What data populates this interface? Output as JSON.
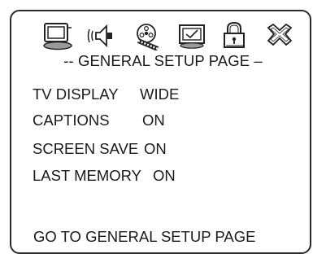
{
  "toolbar": {
    "icons": [
      "tv-icon",
      "speaker-icon",
      "video-reel-icon",
      "preference-icon",
      "lock-icon",
      "exit-icon"
    ]
  },
  "page": {
    "title": "-- GENERAL SETUP PAGE –"
  },
  "settings": [
    {
      "label": "TV DISPLAY",
      "value": "WIDE"
    },
    {
      "label": "CAPTIONS",
      "value": "ON"
    },
    {
      "label": "SCREEN SAVE",
      "value": "ON"
    },
    {
      "label": "LAST MEMORY",
      "value": "ON"
    }
  ],
  "footer": {
    "hint": "GO TO GENERAL SETUP PAGE"
  }
}
